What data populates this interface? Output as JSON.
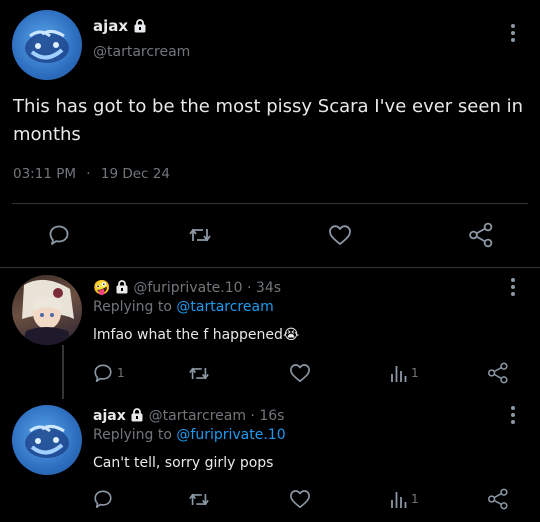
{
  "main_tweet": {
    "display_name": "ajax",
    "handle": "@tartarcream",
    "text": "This has got to be the most pissy Scara I've ever seen in months",
    "time": "03:11 PM",
    "separator": "·",
    "date": "19 Dec 24"
  },
  "reply1": {
    "emoji": "🤪",
    "handle": "@furiprivate.10",
    "separator": "·",
    "age": "34s",
    "replying_prefix": "Replying to",
    "replying_handle": "@tartarcream",
    "text": "lmfao what the f happened",
    "text_emoji": "😭",
    "reply_count": "1",
    "views_count": "1"
  },
  "reply2": {
    "display_name": "ajax",
    "handle": "@tartarcream",
    "separator": "·",
    "age": "16s",
    "replying_prefix": "Replying to",
    "replying_handle": "@furiprivate.10",
    "text": "Can't tell, sorry girly pops",
    "views_count": "1"
  },
  "icons": [
    "lock-icon",
    "more-vertical-icon",
    "reply-icon",
    "retweet-icon",
    "like-icon",
    "views-icon",
    "share-icon"
  ],
  "colors": {
    "background": "#000000",
    "text": "#e7e9ea",
    "muted": "#71767b",
    "link": "#1d9bf0",
    "divider": "#2f3336"
  }
}
